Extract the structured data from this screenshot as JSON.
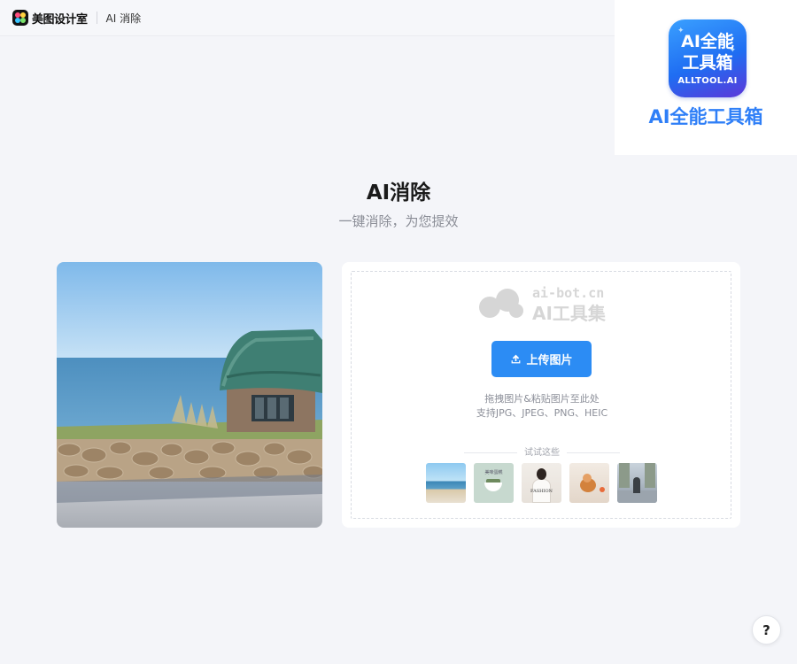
{
  "topbar": {
    "brand_name": "美图设计室",
    "page_name": "AI 消除"
  },
  "overlay_badge": {
    "icon_line1": "AI全能",
    "icon_line2": "工具箱",
    "icon_line3": "ALLTOOL.AI",
    "title": "AI全能工具箱",
    "accent_color": "#2f7ff7"
  },
  "hero": {
    "title": "AI消除",
    "subtitle": "一键消除，为您提效"
  },
  "upload": {
    "watermark_url": "ai-bot.cn",
    "watermark_name": "AI工具集",
    "button_label": "上传图片",
    "button_icon": "upload-icon",
    "hint_line1": "拖拽图片&粘贴图片至此处",
    "hint_line2": "支持JPG、JPEG、PNG、HEIC",
    "try_label": "试试这些",
    "sample_2_text": "美味蛋糕",
    "sample_3_text": "FASHION",
    "accent_color": "#2c8cf4"
  },
  "help": {
    "label": "?"
  }
}
